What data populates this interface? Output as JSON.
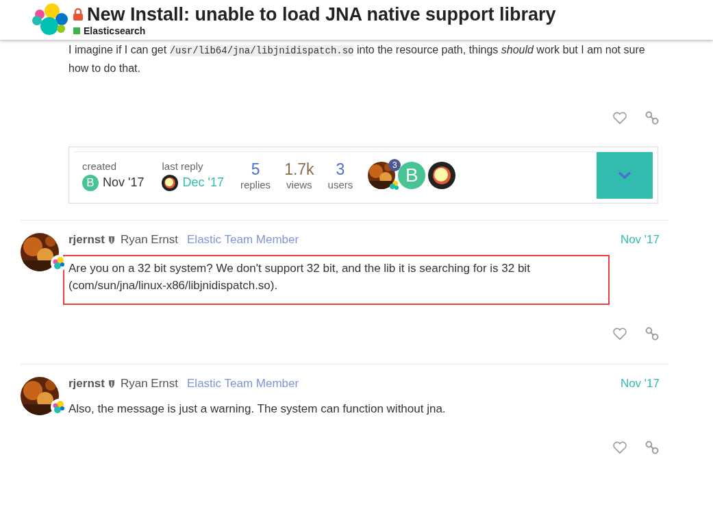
{
  "header": {
    "locked": true,
    "title": "New Install: unable to load JNA native support library",
    "category": {
      "name": "Elasticsearch",
      "color": "#3ab54a"
    }
  },
  "previous_post": {
    "parts": [
      {
        "kind": "plain",
        "text": "I imagine if I can get "
      },
      {
        "kind": "code",
        "text": "/usr/lib64/jna/libjnidispatch.so"
      },
      {
        "kind": "plain",
        "text": " into the resource path, things *should* work but I am not sure how to do that."
      }
    ]
  },
  "topic_map": {
    "created": {
      "label": "created",
      "avatar_letter": "B",
      "date": "Nov '17"
    },
    "last_reply": {
      "label": "last reply",
      "date": "Dec '17"
    },
    "stats": [
      {
        "value": "5",
        "label": "replies",
        "kind": "count"
      },
      {
        "value": "1.7k",
        "label": "views",
        "kind": "views"
      },
      {
        "value": "3",
        "label": "users",
        "kind": "count"
      }
    ],
    "participants": [
      {
        "badge": "3"
      },
      {
        "kind": "letter",
        "letter": "B"
      },
      {
        "kind": "bubble"
      }
    ],
    "expanded": false
  },
  "posts": [
    {
      "username": "rjernst",
      "name": "Ryan Ernst",
      "title": "Elastic Team Member",
      "date": "Nov '17",
      "body": [
        "Are you on a 32 bit system? We don't support 32 bit, and the lib it is searching for is 32 bit",
        "(com/sun/jna/linux-x86/libjnidispatch.so)."
      ],
      "highlighted": true
    },
    {
      "username": "rjernst",
      "name": "Ryan Ernst",
      "title": "Elastic Team Member",
      "date": "Nov '17",
      "body": [
        "Also, the message is just a warning. The system can function without jna."
      ],
      "highlighted": false
    }
  ]
}
